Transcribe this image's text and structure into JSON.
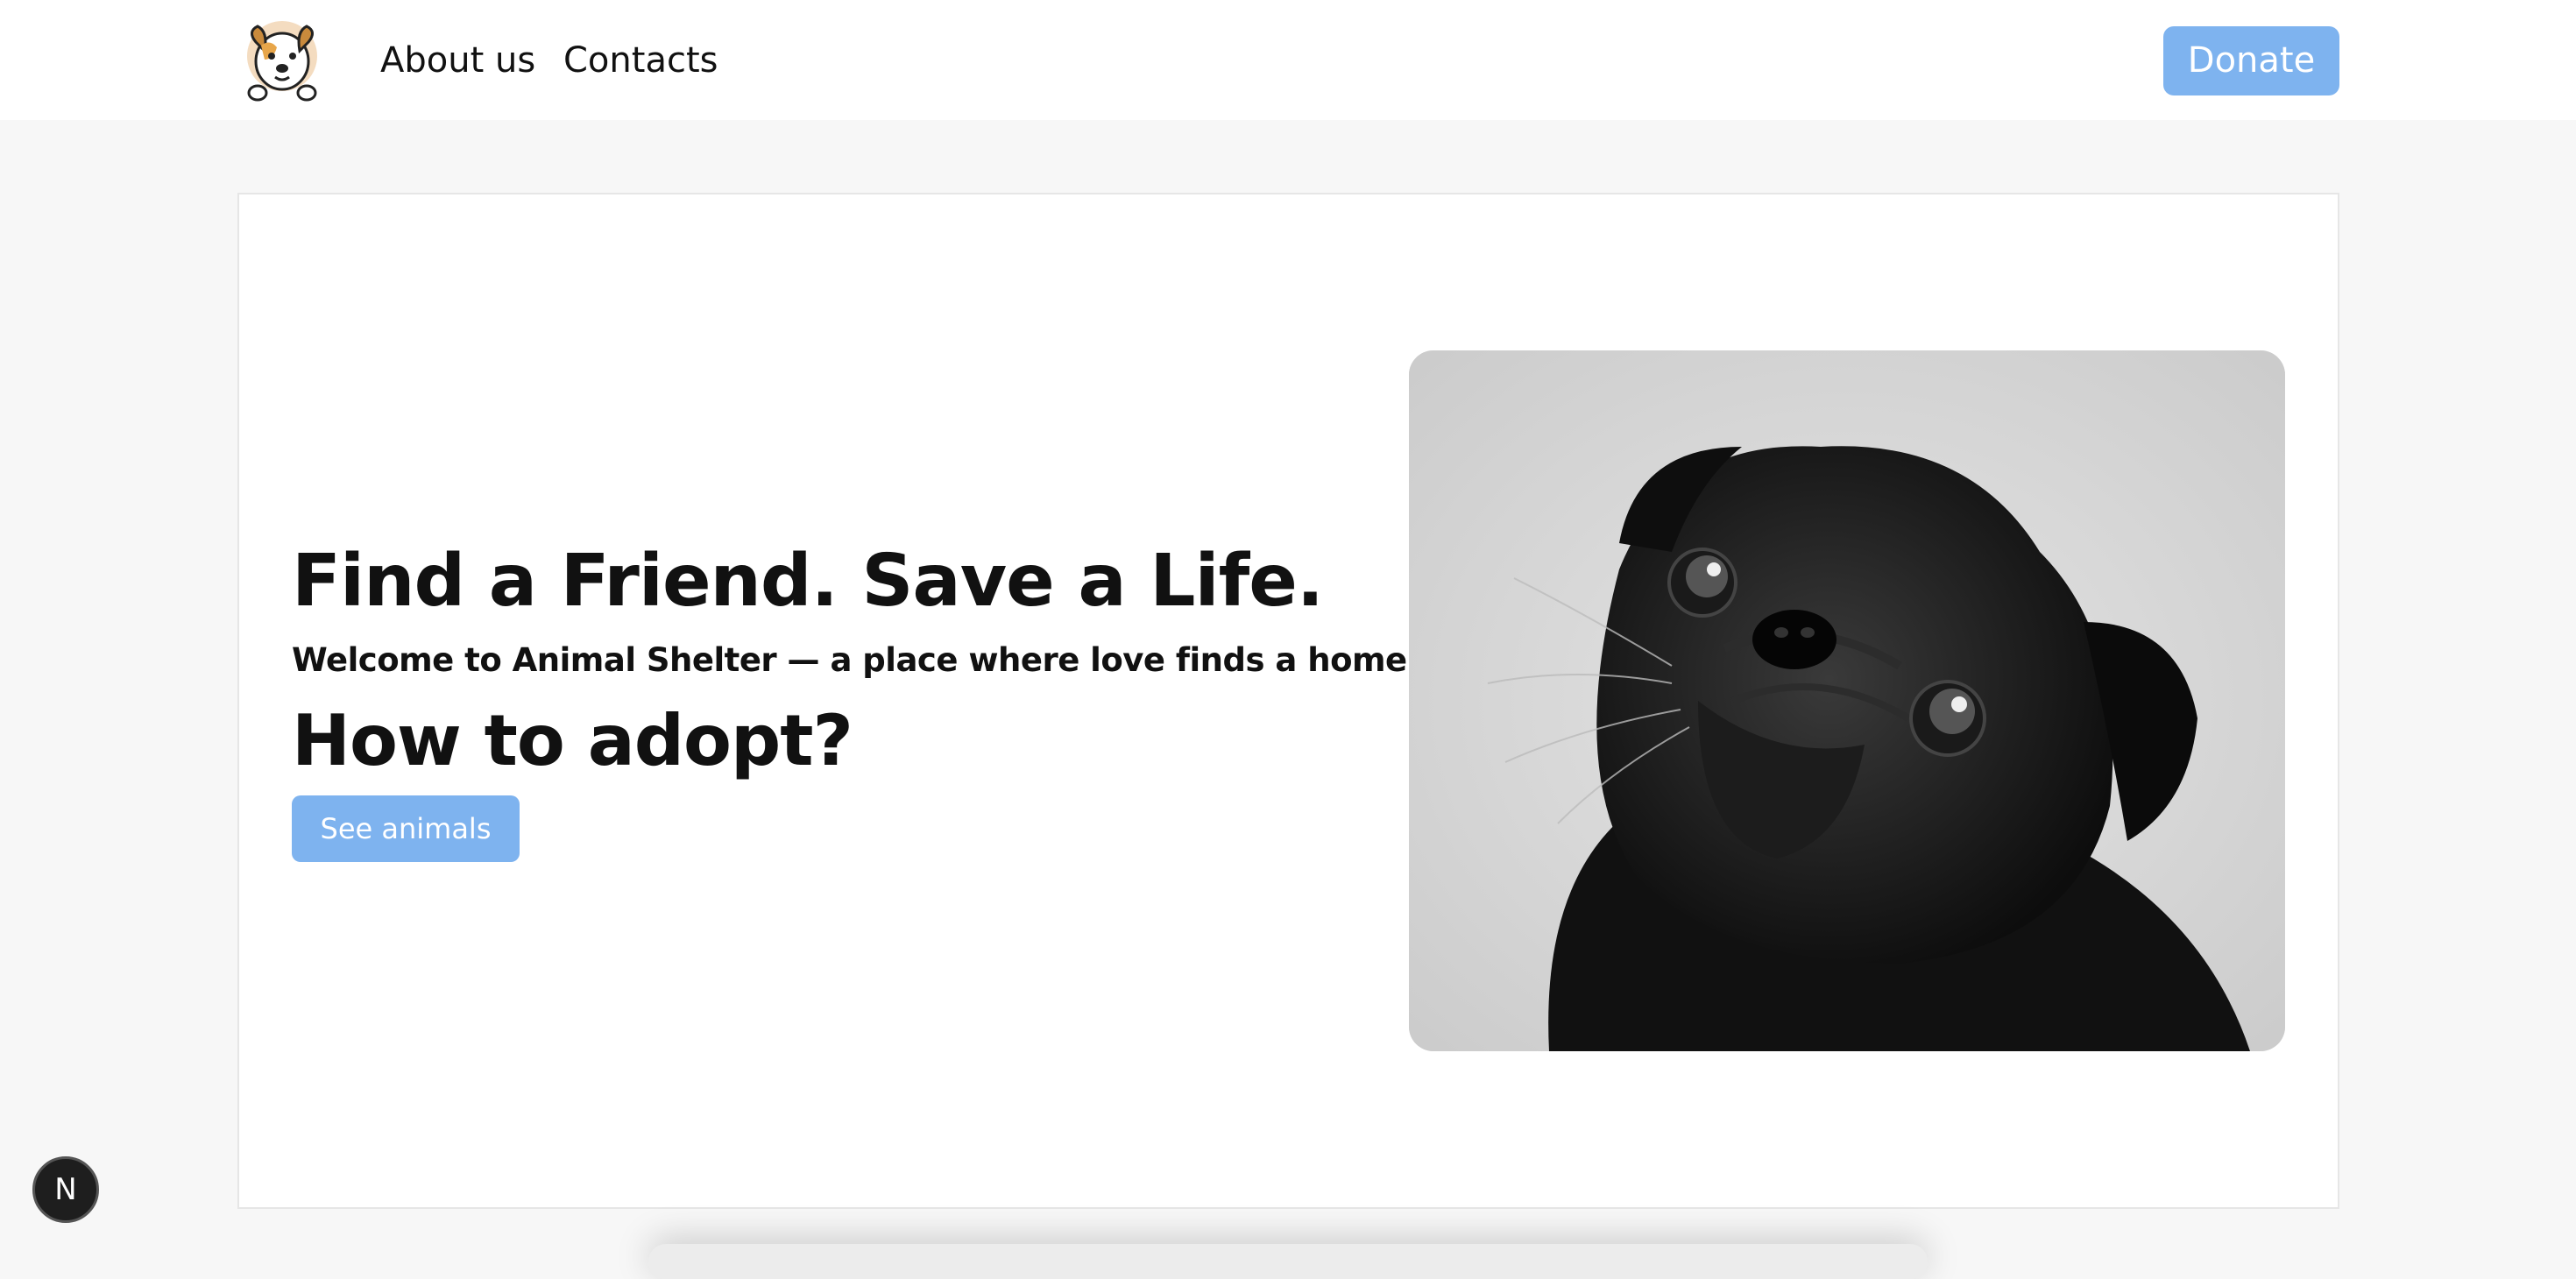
{
  "header": {
    "logo_icon": "dog-face-logo-icon",
    "nav": {
      "about": "About us",
      "contacts": "Contacts"
    },
    "donate_label": "Donate"
  },
  "hero": {
    "title": "Find a Friend. Save a Life.",
    "subtitle": "Welcome to Animal Shelter — a place where love finds a home.",
    "heading": "How to adopt?",
    "cta_label": "See animals",
    "image_icon": "pug-photo"
  },
  "dev_badge": {
    "label": "N",
    "icon": "nextjs-logo-icon"
  },
  "colors": {
    "accent": "#7eb3ef",
    "background": "#f7f7f7",
    "card": "#ffffff",
    "text": "#111111"
  }
}
